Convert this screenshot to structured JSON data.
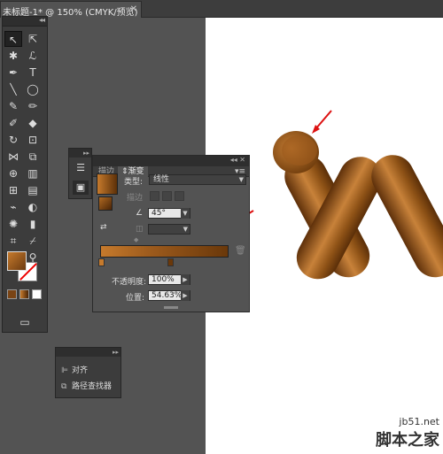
{
  "document": {
    "tab_title": "未标题-1* @ 150% (CMYK/预览)",
    "close_glyph": "✕"
  },
  "tools": {
    "collapse_glyph": "◂◂",
    "items": [
      "selection-tool",
      "direct-selection-tool",
      "magic-wand-tool",
      "lasso-tool",
      "pen-tool",
      "type-tool",
      "line-tool",
      "ellipse-tool",
      "paintbrush-tool",
      "pencil-tool",
      "blob-brush-tool",
      "eraser-tool",
      "rotate-tool",
      "scale-tool",
      "width-tool",
      "free-transform-tool",
      "shape-builder-tool",
      "graph-tool",
      "mesh-tool",
      "gradient-tool",
      "eyedropper-tool",
      "blend-tool",
      "symbol-sprayer-tool",
      "column-graph-tool",
      "artboard-tool",
      "slice-tool",
      "hand-tool",
      "zoom-tool"
    ]
  },
  "gradient_panel": {
    "tab_stroke": "描边",
    "tab_gradient": "渐变",
    "type_label": "类型:",
    "type_value": "线性",
    "stroke_label": "描边",
    "angle_value": "45°",
    "opacity_label": "不透明度:",
    "opacity_value": "100%",
    "location_label": "位置:",
    "location_value": "54.63%",
    "colors": {
      "start": "#c67a2c",
      "end": "#6a380a"
    }
  },
  "align_panel": {
    "align_label": "对齐",
    "pathfinder_label": "路径查找器"
  },
  "watermark": {
    "url": "jb51.net",
    "text": "脚本之家"
  }
}
